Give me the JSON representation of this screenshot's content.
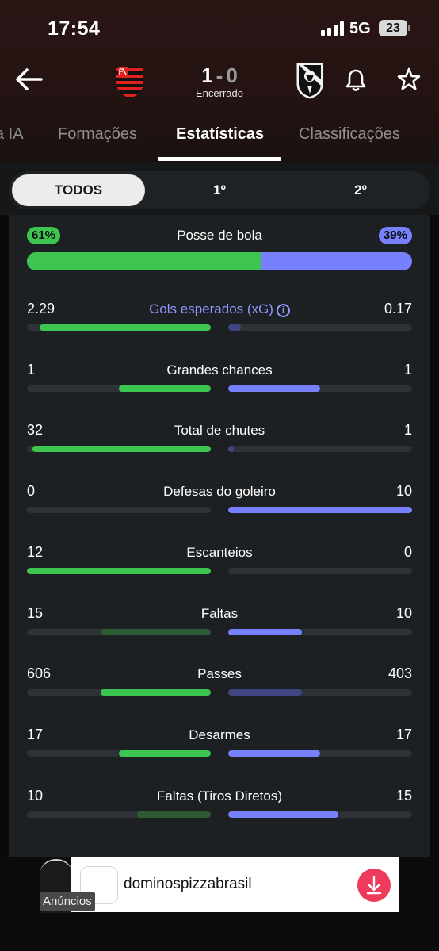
{
  "status_bar": {
    "time": "17:54",
    "network": "5G",
    "battery": "23"
  },
  "match": {
    "home_score": "1",
    "separator": "-",
    "away_score": "0",
    "status": "Encerrado"
  },
  "tabs": [
    {
      "label": "a IA"
    },
    {
      "label": "Formações"
    },
    {
      "label": "Estatísticas",
      "active": true
    },
    {
      "label": "Classificações"
    }
  ],
  "periods": [
    {
      "label": "TODOS",
      "active": true
    },
    {
      "label": "1º"
    },
    {
      "label": "2º"
    }
  ],
  "possession": {
    "label": "Posse de bola",
    "home": "61%",
    "away": "39%",
    "home_fraction": 0.61
  },
  "stats": [
    {
      "label": "Gols esperados (xG)",
      "info_icon": "ⓘ",
      "home": "2.29",
      "away": "0.17",
      "home_fill": 0.93,
      "away_fill": 0.07,
      "home_color": "#3ec54f",
      "away_color": "#3f4580"
    },
    {
      "label": "Grandes chances",
      "home": "1",
      "away": "1",
      "home_fill": 0.5,
      "away_fill": 0.5,
      "home_color": "#3ec54f",
      "away_color": "#7781ff"
    },
    {
      "label": "Total de chutes",
      "home": "32",
      "away": "1",
      "home_fill": 0.97,
      "away_fill": 0.03,
      "home_color": "#3ec54f",
      "away_color": "#3f4580"
    },
    {
      "label": "Defesas do goleiro",
      "home": "0",
      "away": "10",
      "home_fill": 0.0,
      "away_fill": 1.0,
      "home_color": "#3ec54f",
      "away_color": "#7781ff"
    },
    {
      "label": "Escanteios",
      "home": "12",
      "away": "0",
      "home_fill": 1.0,
      "away_fill": 0.0,
      "home_color": "#3ec54f",
      "away_color": "#7781ff"
    },
    {
      "label": "Faltas",
      "home": "15",
      "away": "10",
      "home_fill": 0.6,
      "away_fill": 0.4,
      "home_color": "#2e5a33",
      "away_color": "#7781ff"
    },
    {
      "label": "Passes",
      "home": "606",
      "away": "403",
      "home_fill": 0.6,
      "away_fill": 0.4,
      "home_color": "#3ec54f",
      "away_color": "#3f4580"
    },
    {
      "label": "Desarmes",
      "home": "17",
      "away": "17",
      "home_fill": 0.5,
      "away_fill": 0.5,
      "home_color": "#3ec54f",
      "away_color": "#7781ff"
    },
    {
      "label": "Faltas (Tiros Diretos)",
      "home": "10",
      "away": "15",
      "home_fill": 0.4,
      "away_fill": 0.6,
      "home_color": "#2e5a33",
      "away_color": "#7781ff"
    }
  ],
  "ad": {
    "label": "Anúncios",
    "advertiser": "dominospizzabrasil"
  },
  "colors": {
    "home": "#3ec54f",
    "away": "#7781ff",
    "ad_button": "#ee3b5b"
  }
}
